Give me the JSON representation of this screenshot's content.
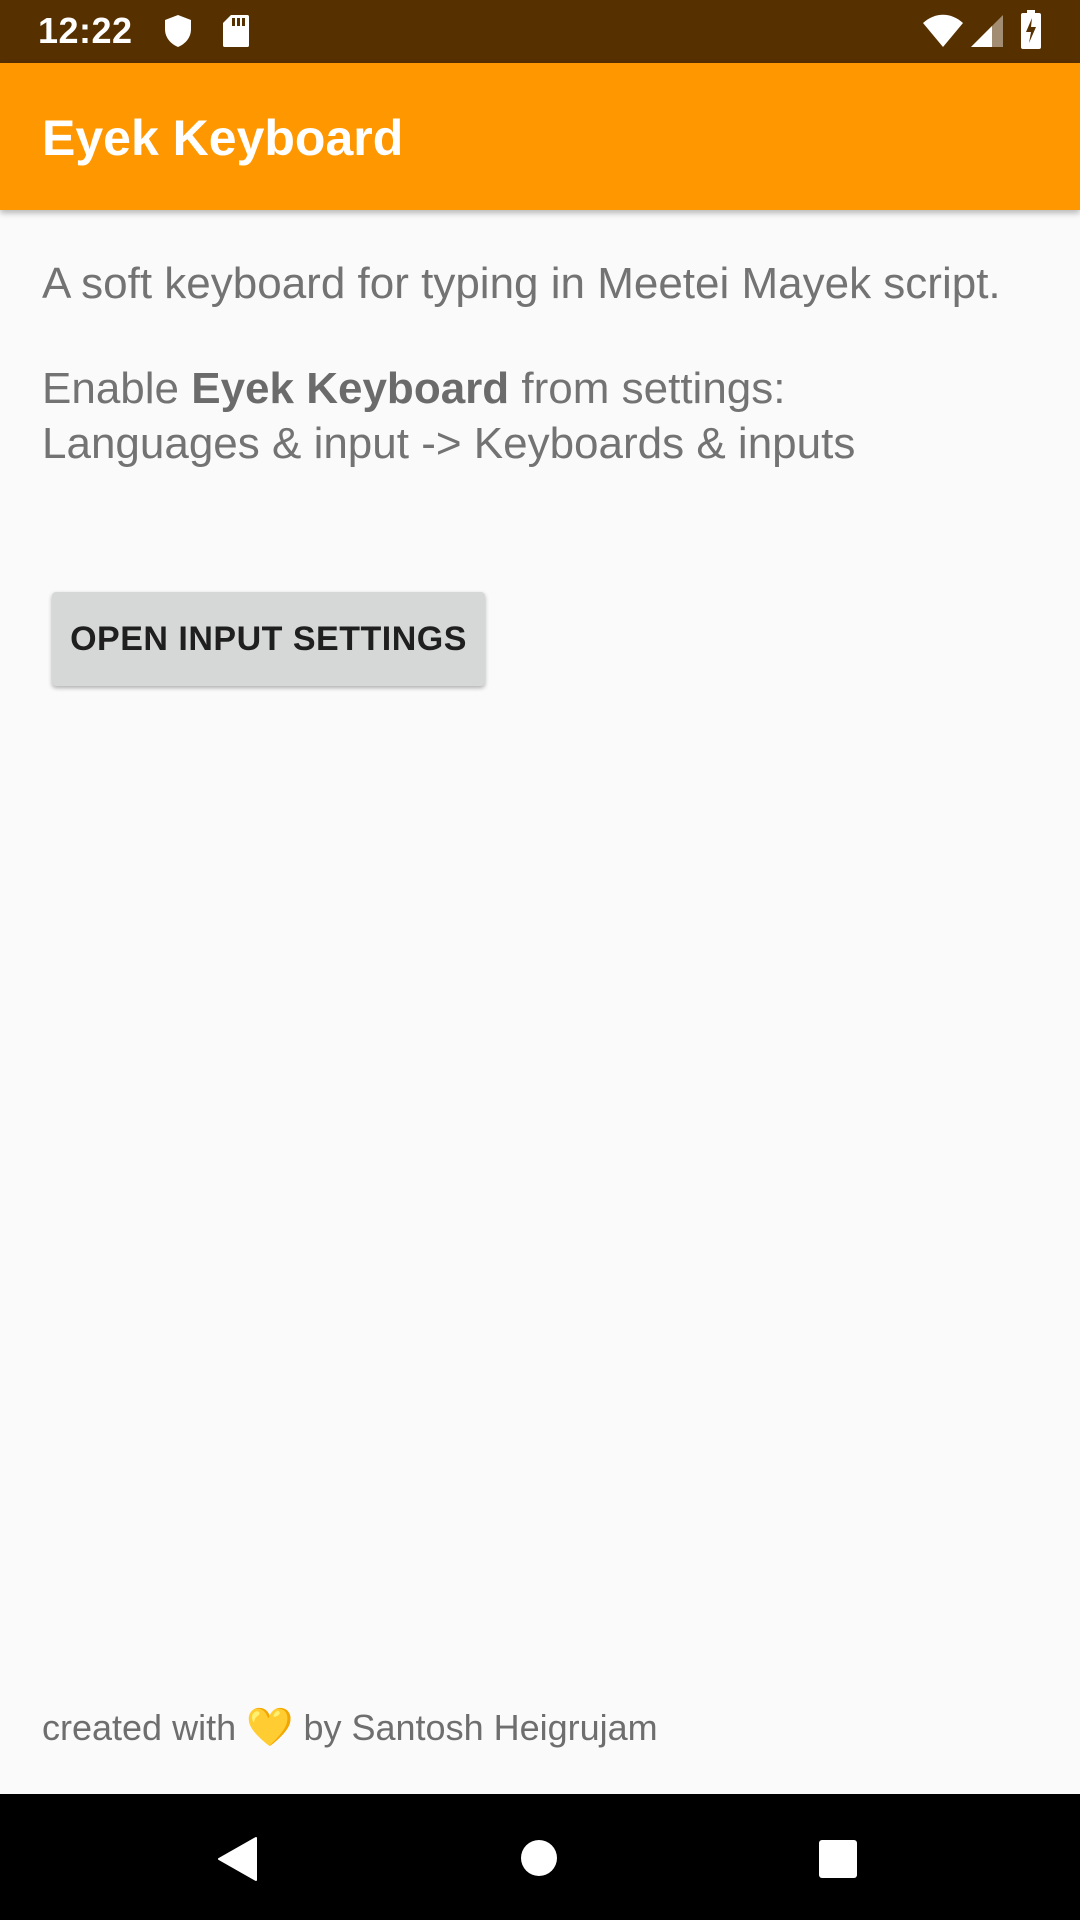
{
  "status_bar": {
    "time": "12:22",
    "icons": [
      "shield-icon",
      "sd-card-icon",
      "wifi-icon",
      "signal-icon",
      "battery-icon"
    ]
  },
  "app_bar": {
    "title": "Eyek Keyboard",
    "color": "#ff9800"
  },
  "content": {
    "description": "A soft keyboard for typing in Meetei Mayek script.",
    "enable_prefix": "Enable ",
    "enable_app_name": "Eyek Keyboard",
    "enable_suffix": " from settings:",
    "settings_path": "Languages & input -> Keyboards & inputs",
    "open_settings_button": "OPEN INPUT SETTINGS"
  },
  "footer": {
    "prefix": "created with",
    "heart": "💛",
    "suffix": "by Santosh Heigrujam"
  },
  "nav_bar": {
    "buttons": [
      "back-icon",
      "home-icon",
      "recents-icon"
    ]
  }
}
